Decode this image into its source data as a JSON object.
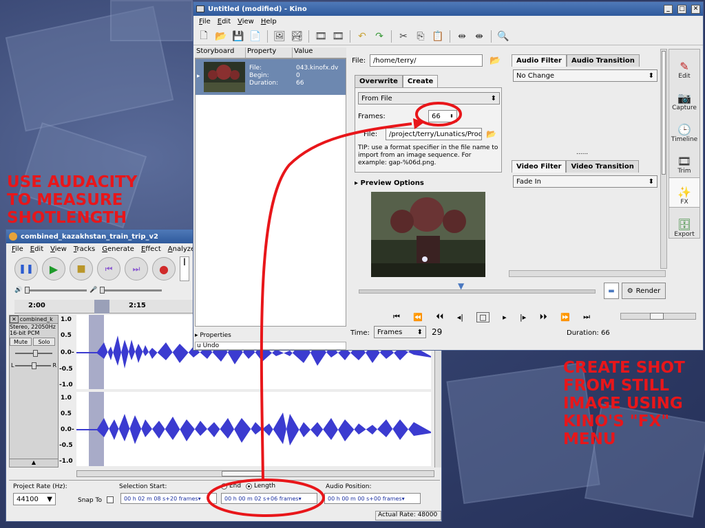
{
  "annotations": {
    "left": [
      "USE AUDACITY",
      "TO MEASURE",
      "SHOTLENGTH"
    ],
    "right": [
      "CREATE SHOT",
      "FROM STILL",
      "IMAGE USING",
      "KINO'S \"FX\"",
      "MENU"
    ]
  },
  "kino": {
    "title": "Untitled (modified) - Kino",
    "menu": [
      "File",
      "Edit",
      "View",
      "Help"
    ],
    "sb_headers": [
      "Storyboard",
      "Property",
      "Value"
    ],
    "clip": {
      "file_k": "File:",
      "file_v": "043.kinofx.dv",
      "begin_k": "Begin:",
      "begin_v": "0",
      "dur_k": "Duration:",
      "dur_v": "66"
    },
    "properties": "Properties",
    "undo": "Undo",
    "file_label": "File:",
    "file_path": "/home/terry/",
    "tabs": [
      "Overwrite",
      "Create"
    ],
    "source": "From File",
    "frames_label": "Frames:",
    "frames_value": "66",
    "file2_label": "File:",
    "file2_path": "/project/terry/Lunatics/Produ",
    "tip": "TIP: use a format specifier in the file name to import from an image sequence. For example: gap-%06d.png.",
    "preview_options": "Preview Options",
    "audio_tabs": [
      "Audio Filter",
      "Audio Transition"
    ],
    "audio_value": "No Change",
    "video_tabs": [
      "Video Filter",
      "Video Transition"
    ],
    "video_value": "Fade In",
    "divider": "......",
    "render": "Render",
    "time_label": "Time:",
    "time_mode": "Frames",
    "time_value": "29",
    "duration": "Duration: 66",
    "side": [
      "Edit",
      "Capture",
      "Timeline",
      "Trim",
      "FX",
      "Export"
    ]
  },
  "audacity": {
    "title": "combined_kazakhstan_train_trip_v2",
    "menu": [
      "File",
      "Edit",
      "View",
      "Tracks",
      "Generate",
      "Effect",
      "Analyze"
    ],
    "ruler": [
      "2:00",
      "2:15"
    ],
    "track": {
      "name": "combined_k",
      "info1": "Stereo, 22050Hz",
      "info2": "16-bit PCM",
      "mute": "Mute",
      "solo": "Solo",
      "l": "L",
      "r": "R"
    },
    "ylabels": [
      "1.0",
      "0.5",
      "0.0-",
      "-0.5",
      "-1.0"
    ],
    "rate_label": "Project Rate (Hz):",
    "rate_value": "44100",
    "snap": "Snap To",
    "sel_label": "Selection Start:",
    "end_label": "End",
    "length_label": "Length",
    "audio_pos": "Audio Position:",
    "sel_value": "00 h 02 m 08 s+20 frames",
    "len_value": "00 h 00 m 02 s+06 frames",
    "pos_value": "00 h 00 m 00 s+00 frames",
    "actual": "Actual Rate: 48000"
  }
}
